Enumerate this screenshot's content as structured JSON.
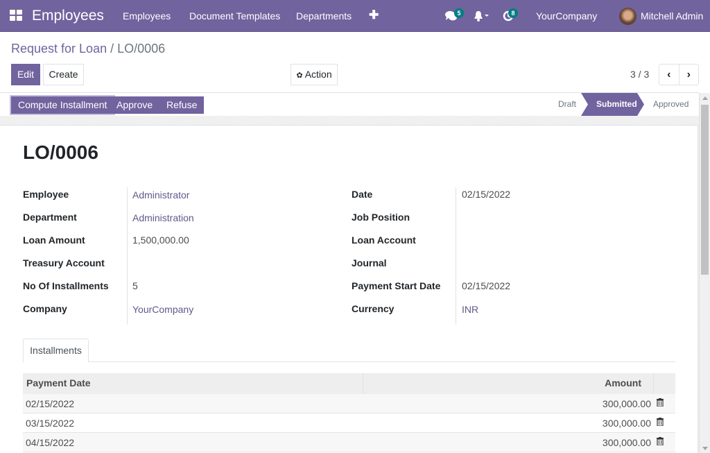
{
  "navbar": {
    "app_title": "Employees",
    "menu": [
      "Employees",
      "Document Templates",
      "Departments"
    ],
    "messages_count": "5",
    "activity_count": "8",
    "company": "YourCompany",
    "user": "Mitchell Admin"
  },
  "breadcrumb": {
    "parent": "Request for Loan",
    "separator": "/",
    "current": "LO/0006"
  },
  "control": {
    "edit_label": "Edit",
    "create_label": "Create",
    "action_label": "Action",
    "pager": "3 / 3"
  },
  "statusbar": {
    "buttons": [
      "Compute Installment",
      "Approve",
      "Refuse"
    ],
    "stages": [
      "Draft",
      "Submitted",
      "Approved"
    ],
    "active_stage": "Submitted"
  },
  "record": {
    "title": "LO/0006",
    "left_fields": [
      {
        "label": "Employee",
        "value": "Administrator"
      },
      {
        "label": "Department",
        "value": "Administration"
      },
      {
        "label": "Loan Amount",
        "value": "1,500,000.00"
      },
      {
        "label": "Treasury Account",
        "value": ""
      },
      {
        "label": "No Of Installments",
        "value": "5"
      },
      {
        "label": "Company",
        "value": "YourCompany"
      }
    ],
    "right_fields": [
      {
        "label": "Date",
        "value": "02/15/2022"
      },
      {
        "label": "Job Position",
        "value": ""
      },
      {
        "label": "Loan Account",
        "value": ""
      },
      {
        "label": "Journal",
        "value": ""
      },
      {
        "label": "Payment Start Date",
        "value": "02/15/2022"
      },
      {
        "label": "Currency",
        "value": "INR"
      }
    ]
  },
  "notebook": {
    "tab": "Installments",
    "columns": [
      "Payment Date",
      "Amount"
    ],
    "rows": [
      {
        "date": "02/15/2022",
        "amount": "300,000.00"
      },
      {
        "date": "03/15/2022",
        "amount": "300,000.00"
      },
      {
        "date": "04/15/2022",
        "amount": "300,000.00"
      }
    ]
  }
}
